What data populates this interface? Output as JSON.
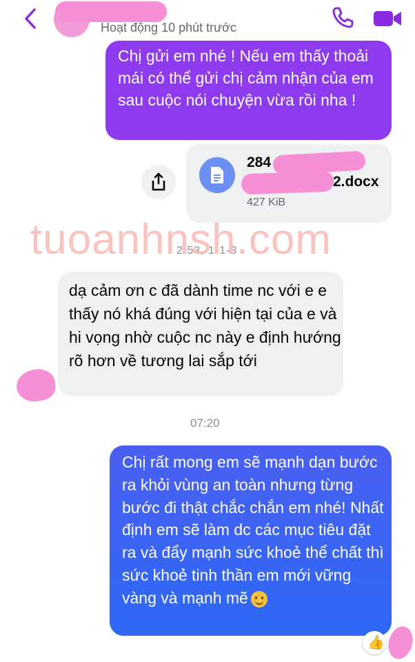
{
  "header": {
    "status": "Hoạt động 10 phút trước"
  },
  "messages": {
    "sent_1": "Chị gửi em nhé ! Nếu em thấy thoải mái có thể gửi chị cảm nhận của em sau cuộc nói chuyện vừa rồi nha !",
    "file": {
      "name_start": "284",
      "name_end": "2.docx",
      "size": "427 KiB"
    },
    "timestamp_1": "2:53, 1-1-3",
    "received_1": "dạ cảm ơn c đã dành time nc với e e thấy nó khá đúng với hiện tại của e và hi vọng nhờ cuộc nc này e định hướng rõ hơn về tương lai sắp tới",
    "timestamp_2": "07:20",
    "sent_2": "Chị rất mong em sẽ mạnh dạn bước ra khỏi vùng an toàn nhưng từng bước đi thật chắc chắn em nhé! Nhất định em sẽ làm dc các mục tiêu đặt ra và đẩy mạnh sức khoẻ thể chất thì sức khoẻ tinh thần em mới vững vàng và mạnh mẽ",
    "reaction": "👍"
  },
  "watermark": "tuoanhnsh.com",
  "colors": {
    "purple_bubble": "#8e3bf0",
    "blue_bubble": "#2d68f4",
    "grey_bubble": "#eff0f2",
    "icon_accent": "#8a2be2"
  },
  "icons": [
    "back-chevron-icon",
    "phone-icon",
    "video-camera-icon",
    "share-icon",
    "document-icon",
    "thumbs-up-icon",
    "smiling-emoji-icon"
  ]
}
